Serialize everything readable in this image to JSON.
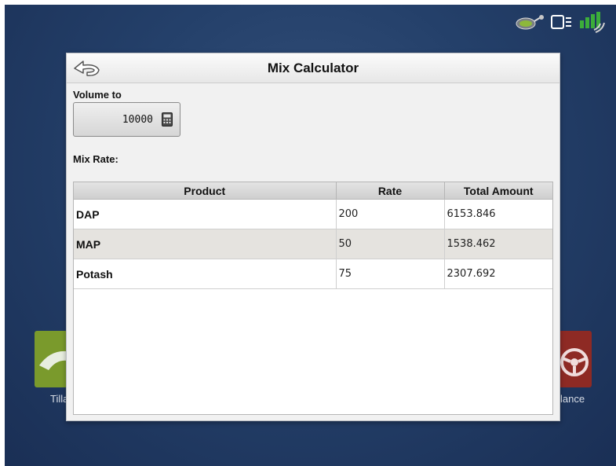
{
  "dialog": {
    "title": "Mix Calculator",
    "volume_label": "Volume to",
    "volume_value": "10000",
    "mix_rate_label": "Mix Rate:"
  },
  "table": {
    "headers": [
      "Product",
      "Rate",
      "Total Amount"
    ],
    "rows": [
      {
        "product": "DAP",
        "rate": "200",
        "total": "6153.846"
      },
      {
        "product": "MAP",
        "rate": "50",
        "total": "1538.462"
      },
      {
        "product": "Potash",
        "rate": "75",
        "total": "2307.692"
      }
    ]
  },
  "background_tiles": {
    "left_label": "Tilla",
    "right_label": "lance"
  },
  "status_icons": [
    "seed-sensor-icon",
    "display-link-icon",
    "gps-signal-icon"
  ],
  "colors": {
    "background": "#24406a",
    "tile_left": "#7a9a2c",
    "tile_right": "#8e2a24",
    "gps_green": "#3cae3a"
  }
}
